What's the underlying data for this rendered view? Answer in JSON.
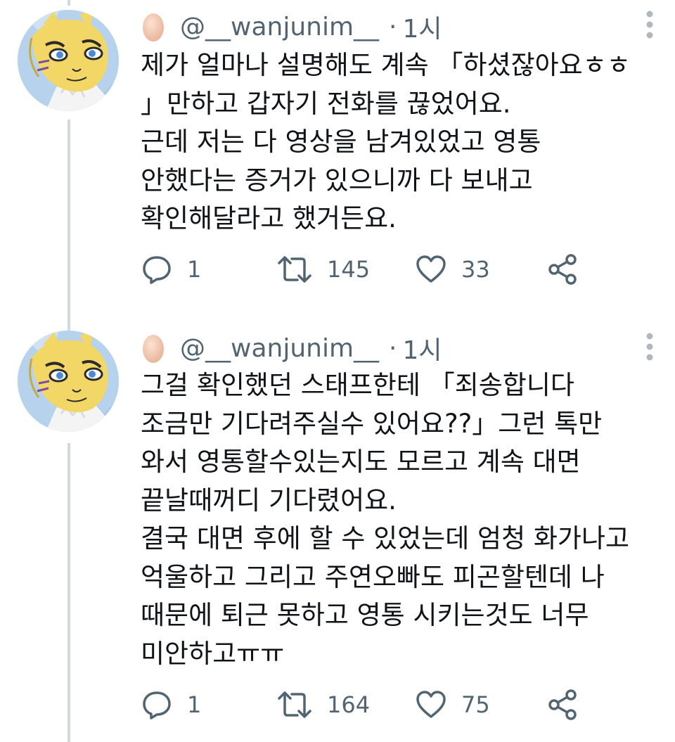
{
  "tweets": [
    {
      "handle": "@__wanjunim__",
      "separator": "·",
      "time": "1시",
      "lines": [
        "제가 얼마나 설명해도 계속 「하셨잖아요ㅎㅎ",
        "」만하고 갑자기 전화를 끊었어요.",
        "근데 저는 다 영상을 남겨있었고 영통",
        "안했다는 증거가 있으니까 다 보내고",
        "확인해달라고 했거든요."
      ],
      "reply_count": "1",
      "retweet_count": "145",
      "like_count": "33"
    },
    {
      "handle": "@__wanjunim__",
      "separator": "·",
      "time": "1시",
      "lines": [
        "그걸 확인했던 스태프한테 「죄송합니다",
        "조금만 기다려주실수 있어요??」그런 톡만",
        "와서 영통할수있는지도 모르고 계속 대면",
        "끝날때꺼디 기다렸어요.",
        "결국 대면 후에 할 수 있었는데 엄청 화가나고",
        "억울하고 그리고 주연오빠도 피곤할텐데 나",
        "때문에 퇴근 못하고 영통 시키는것도 너무",
        "미안하고ㅠㅠ"
      ],
      "reply_count": "1",
      "retweet_count": "164",
      "like_count": "75"
    }
  ],
  "icons": {
    "egg": "egg-icon",
    "more": "more-vertical-icon",
    "reply": "reply-icon",
    "retweet": "retweet-icon",
    "like": "heart-icon",
    "share": "share-icon"
  },
  "colors": {
    "text": "#0f1419",
    "secondary": "#536471",
    "thread_line": "#cfd9de",
    "avatar_yellow": "#f2d766"
  }
}
